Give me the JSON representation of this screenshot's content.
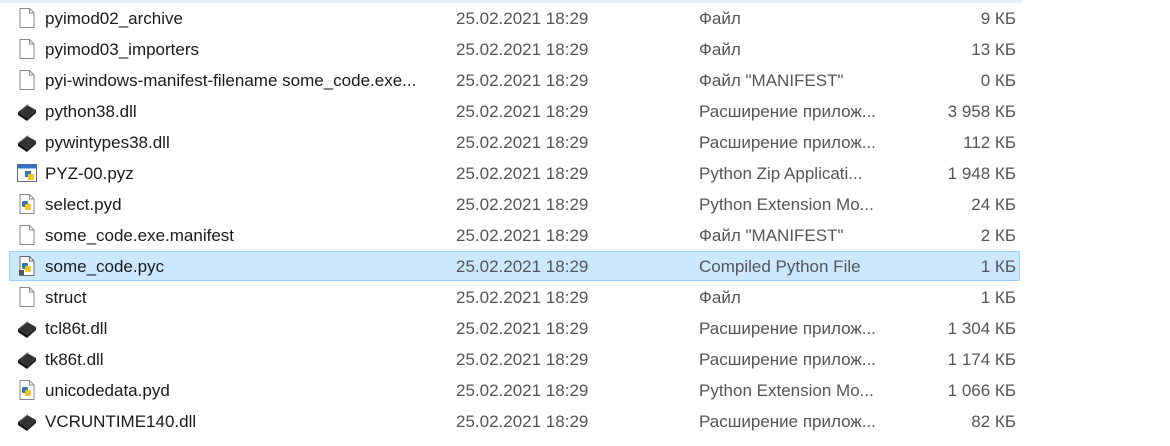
{
  "files": [
    {
      "name": "pyimod02_archive",
      "date": "25.02.2021 18:29",
      "type": "Файл",
      "size": "9 КБ",
      "icon": "file-icon"
    },
    {
      "name": "pyimod03_importers",
      "date": "25.02.2021 18:29",
      "type": "Файл",
      "size": "13 КБ",
      "icon": "file-icon"
    },
    {
      "name": "pyi-windows-manifest-filename some_code.exe...",
      "date": "25.02.2021 18:29",
      "type": "Файл \"MANIFEST\"",
      "size": "0 КБ",
      "icon": "file-icon"
    },
    {
      "name": "python38.dll",
      "date": "25.02.2021 18:29",
      "type": "Расширение прилож...",
      "size": "3 958 КБ",
      "icon": "dll-icon"
    },
    {
      "name": "pywintypes38.dll",
      "date": "25.02.2021 18:29",
      "type": "Расширение прилож...",
      "size": "112 КБ",
      "icon": "dll-icon"
    },
    {
      "name": "PYZ-00.pyz",
      "date": "25.02.2021 18:29",
      "type": "Python Zip Applicati...",
      "size": "1 948 КБ",
      "icon": "python-zip-icon"
    },
    {
      "name": "select.pyd",
      "date": "25.02.2021 18:29",
      "type": "Python Extension Mo...",
      "size": "24 КБ",
      "icon": "python-file-icon"
    },
    {
      "name": "some_code.exe.manifest",
      "date": "25.02.2021 18:29",
      "type": "Файл \"MANIFEST\"",
      "size": "2 КБ",
      "icon": "file-icon"
    },
    {
      "name": "some_code.pyc",
      "date": "25.02.2021 18:29",
      "type": "Compiled Python File",
      "size": "1 КБ",
      "icon": "python-compiled-icon",
      "selected": true
    },
    {
      "name": "struct",
      "date": "25.02.2021 18:29",
      "type": "Файл",
      "size": "1 КБ",
      "icon": "file-icon"
    },
    {
      "name": "tcl86t.dll",
      "date": "25.02.2021 18:29",
      "type": "Расширение прилож...",
      "size": "1 304 КБ",
      "icon": "dll-icon"
    },
    {
      "name": "tk86t.dll",
      "date": "25.02.2021 18:29",
      "type": "Расширение прилож...",
      "size": "1 174 КБ",
      "icon": "dll-icon"
    },
    {
      "name": "unicodedata.pyd",
      "date": "25.02.2021 18:29",
      "type": "Python Extension Mo...",
      "size": "1 066 КБ",
      "icon": "python-file-icon"
    },
    {
      "name": "VCRUNTIME140.dll",
      "date": "25.02.2021 18:29",
      "type": "Расширение прилож...",
      "size": "82 КБ",
      "icon": "dll-icon"
    }
  ],
  "colors": {
    "selection": "#cce8ff",
    "selection_border": "#99d1ff",
    "secondary_text": "#555555"
  }
}
